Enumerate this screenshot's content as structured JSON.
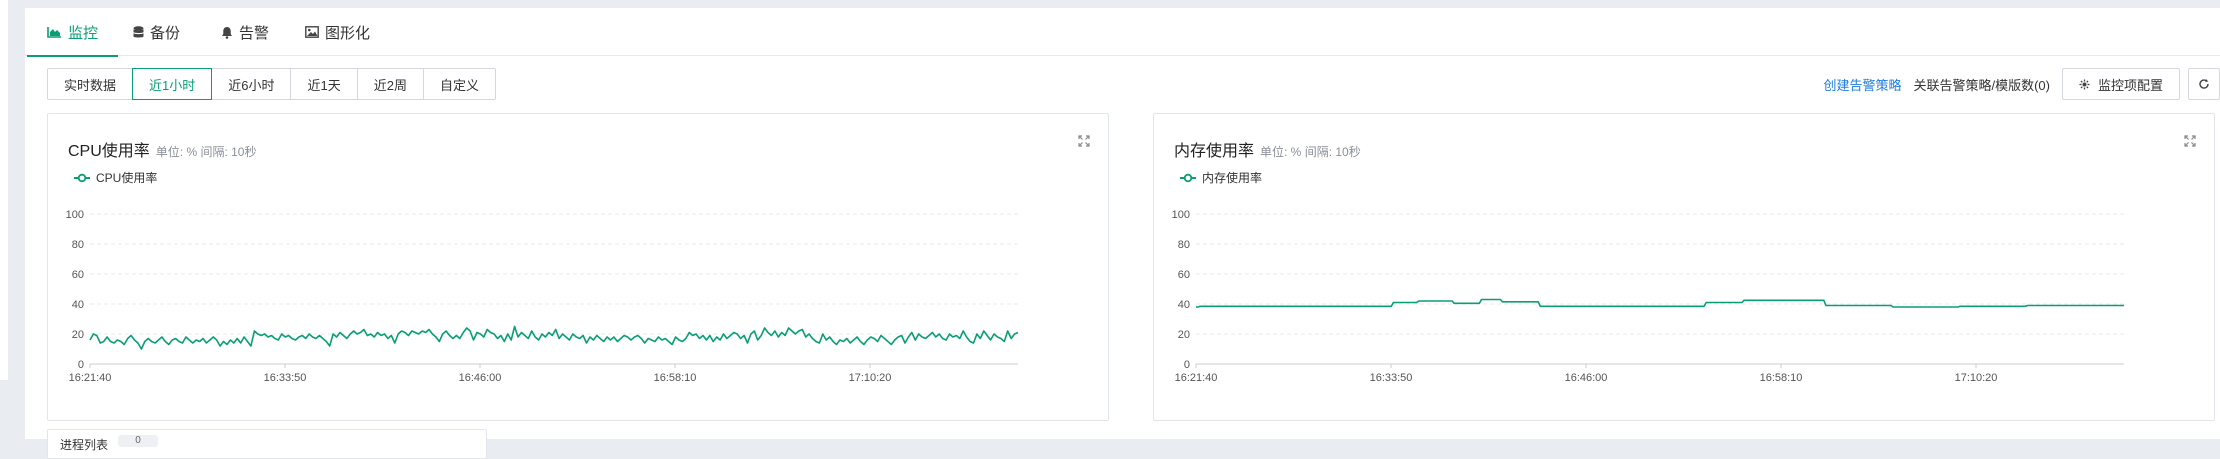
{
  "tabs": [
    {
      "label": "监控",
      "icon": "area-chart-icon",
      "active": true
    },
    {
      "label": "备份",
      "icon": "database-icon",
      "active": false
    },
    {
      "label": "告警",
      "icon": "bell-icon",
      "active": false
    },
    {
      "label": "图形化",
      "icon": "image-icon",
      "active": false
    }
  ],
  "time_ranges": [
    {
      "label": "实时数据",
      "active": false
    },
    {
      "label": "近1小时",
      "active": true
    },
    {
      "label": "近6小时",
      "active": false
    },
    {
      "label": "近1天",
      "active": false
    },
    {
      "label": "近2周",
      "active": false
    },
    {
      "label": "自定义",
      "active": false
    }
  ],
  "actions": {
    "create_alert": "创建告警策略",
    "linked_policies": "关联告警策略/模版数(0)",
    "monitor_config": "监控项配置",
    "refresh_icon": "refresh-icon",
    "config_icon": "settings-icon"
  },
  "colors": {
    "accent": "#0a9d76",
    "link": "#1f7ee0",
    "grid": "#e6e9ee",
    "axis": "#c9ced6"
  },
  "charts": [
    {
      "title": "CPU使用率",
      "subtitle": "单位: % 间隔: 10秒",
      "legend": "CPU使用率"
    },
    {
      "title": "内存使用率",
      "subtitle": "单位: % 间隔: 10秒",
      "legend": "内存使用率"
    }
  ],
  "chart_data": [
    {
      "type": "line",
      "title": "CPU使用率",
      "ylim": [
        0,
        100
      ],
      "yticks": [
        0,
        20,
        40,
        60,
        80,
        100
      ],
      "xticks": [
        "16:21:40",
        "16:33:50",
        "16:46:00",
        "16:58:10",
        "17:10:20"
      ],
      "grid": true,
      "legend_position": "top-left",
      "series": [
        {
          "name": "CPU使用率",
          "color": "#0a9d76",
          "values": [
            16,
            20,
            19,
            14,
            15,
            18,
            15,
            14,
            16,
            15,
            13,
            17,
            19,
            16,
            14,
            10,
            15,
            17,
            15,
            14,
            16,
            18,
            15,
            13,
            16,
            17,
            15,
            14,
            18,
            16,
            14,
            16,
            15,
            17,
            14,
            16,
            18,
            16,
            12,
            15,
            13,
            16,
            14,
            17,
            14,
            18,
            15,
            12,
            22,
            20,
            19,
            20,
            18,
            19,
            17,
            16,
            20,
            18,
            19,
            17,
            16,
            18,
            19,
            17,
            20,
            18,
            17,
            19,
            17,
            15,
            12,
            20,
            18,
            21,
            19,
            17,
            20,
            22,
            20,
            21,
            23,
            19,
            20,
            18,
            21,
            19,
            20,
            17,
            19,
            14,
            20,
            22,
            21,
            19,
            22,
            21,
            20,
            22,
            21,
            23,
            20,
            18,
            15,
            20,
            22,
            19,
            17,
            19,
            17,
            21,
            24,
            22,
            16,
            21,
            20,
            18,
            23,
            21,
            20,
            17,
            19,
            15,
            20,
            16,
            25,
            18,
            21,
            19,
            17,
            22,
            18,
            16,
            20,
            18,
            21,
            19,
            23,
            17,
            20,
            18,
            16,
            20,
            18,
            17,
            19,
            14,
            18,
            16,
            19,
            17,
            15,
            18,
            16,
            18,
            15,
            17,
            19,
            18,
            16,
            18,
            19,
            17,
            14,
            17,
            16,
            15,
            18,
            16,
            17,
            15,
            13,
            18,
            16,
            15,
            17,
            21,
            19,
            20,
            17,
            19,
            16,
            19,
            15,
            18,
            16,
            20,
            17,
            19,
            21,
            20,
            17,
            19,
            14,
            20,
            22,
            16,
            19,
            24,
            21,
            19,
            22,
            18,
            21,
            19,
            24,
            22,
            20,
            22,
            23,
            18,
            20,
            17,
            15,
            14,
            20,
            16,
            18,
            15,
            13,
            16,
            15,
            17,
            14,
            16,
            18,
            15,
            13,
            16,
            18,
            17,
            15,
            19,
            17,
            15,
            13,
            16,
            18,
            19,
            14,
            18,
            21,
            16,
            20,
            18,
            17,
            19,
            21,
            18,
            20,
            17,
            16,
            20,
            18,
            19,
            17,
            22,
            18,
            15,
            14,
            20,
            17,
            22,
            19,
            16,
            20,
            18,
            17,
            15,
            22,
            17,
            20,
            21
          ]
        }
      ]
    },
    {
      "type": "line",
      "title": "内存使用率",
      "ylim": [
        0,
        100
      ],
      "yticks": [
        0,
        20,
        40,
        60,
        80,
        100
      ],
      "xticks": [
        "16:21:40",
        "16:33:50",
        "16:46:00",
        "16:58:10",
        "17:10:20"
      ],
      "grid": true,
      "legend_position": "top-left",
      "series": [
        {
          "name": "内存使用率",
          "color": "#0a9d76",
          "values": [
            38,
            38,
            38.5,
            38.5,
            38.5,
            38.5,
            38.5,
            38.5,
            38.5,
            38.5,
            38.5,
            38.5,
            38.5,
            38.5,
            38.5,
            38.5,
            38.5,
            38.5,
            38.5,
            38.5,
            38.5,
            38.5,
            38.5,
            38.5,
            38.5,
            38.5,
            38.5,
            38.5,
            38.5,
            38.5,
            38.5,
            38.5,
            38.5,
            38.5,
            38.5,
            38.5,
            38.5,
            38.5,
            38.5,
            38.5,
            38.5,
            38.5,
            38.5,
            38.5,
            38.5,
            38.5,
            38.5,
            38.5,
            38.5,
            38.5,
            38.5,
            38.5,
            38.5,
            38.5,
            38.5,
            38.5,
            38.5,
            38.5,
            38.5,
            38.5,
            38.5,
            38.5,
            38.5,
            38.5,
            38.5,
            38.5,
            38.5,
            38.5,
            38.5,
            38.5,
            38.5,
            38.5,
            38.5,
            38.5,
            38.5,
            38.5,
            38.5,
            38.5,
            38.5,
            38.5,
            38.5,
            38.5,
            38.5,
            38.5,
            38.5,
            38.5,
            38.5,
            38.5,
            38.5,
            38.5,
            38.5,
            38.5,
            38.5,
            38.5,
            41,
            41,
            41,
            41,
            41,
            41,
            41,
            41,
            41,
            41,
            41,
            41,
            42,
            42,
            42,
            42,
            42,
            42,
            42,
            42,
            42,
            42,
            42,
            42,
            42,
            42,
            42,
            42,
            42,
            40.5,
            40.5,
            40.5,
            40.5,
            40.5,
            40.5,
            40.5,
            40.5,
            40.5,
            40.5,
            40.5,
            40.5,
            40.5,
            43,
            43,
            43,
            43,
            43,
            43,
            43,
            43,
            43,
            43,
            41.5,
            41.5,
            41.5,
            41.5,
            41.5,
            41.5,
            41.5,
            41.5,
            41.5,
            41.5,
            41.5,
            41.5,
            41.5,
            41.5,
            41.5,
            41.5,
            41.5,
            41.5,
            38.5,
            38.5,
            38.5,
            38.5,
            38.5,
            38.5,
            38.5,
            38.5,
            38.5,
            38.5,
            38.5,
            38.5,
            38.5,
            38.5,
            38.5,
            38.5,
            38.5,
            38.5,
            38.5,
            38.5,
            38.5,
            38.5,
            38.5,
            38.5,
            38.5,
            38.5,
            38.5,
            38.5,
            38.5,
            38.5,
            38.5,
            38.5,
            38.5,
            38.5,
            38.5,
            38.5,
            38.5,
            38.5,
            38.5,
            38.5,
            38.5,
            38.5,
            38.5,
            38.5,
            38.5,
            38.5,
            38.5,
            38.5,
            38.5,
            38.5,
            38.5,
            38.5,
            38.5,
            38.5,
            38.5,
            38.5,
            38.5,
            38.5,
            38.5,
            38.5,
            38.5,
            38.5,
            38.5,
            38.5,
            38.5,
            38.5,
            38.5,
            38.5,
            38.5,
            38.5,
            38.5,
            38.5,
            38.5,
            38.5,
            38.5,
            38.5,
            38.5,
            38.5,
            38.5,
            41,
            41,
            41,
            41,
            41,
            41,
            41,
            41,
            41,
            41,
            41,
            41,
            41,
            41,
            41,
            41,
            41,
            41,
            42.5,
            42.5,
            42.5,
            42.5,
            42.5,
            42.5,
            42.5,
            42.5,
            42.5,
            42.5,
            42.5,
            42.5,
            42.5,
            42.5,
            42.5,
            42.5,
            42.5,
            42.5,
            42.5,
            42.5,
            42.5,
            42.5,
            42.5,
            42.5,
            42.5,
            42.5,
            42.5,
            42.5,
            42.5,
            42.5,
            42.5,
            42.5,
            42.5,
            42.5,
            42.5,
            42.5,
            42.5,
            42.5,
            42.5,
            39,
            39,
            39,
            39,
            39,
            39,
            39,
            39,
            39,
            39,
            39,
            39,
            39,
            39,
            39,
            39,
            39,
            39,
            39,
            39,
            39,
            39,
            39,
            39,
            39,
            39,
            39,
            39,
            39,
            39,
            39,
            39,
            38,
            38,
            38,
            38,
            38,
            38,
            38,
            38,
            38,
            38,
            38,
            38,
            38,
            38,
            38,
            38,
            38,
            38,
            38,
            38,
            38,
            38,
            38,
            38,
            38,
            38,
            38,
            38,
            38,
            38,
            38,
            38,
            38.5,
            38.5,
            38.5,
            38.5,
            38.5,
            38.5,
            38.5,
            38.5,
            38.5,
            38.5,
            38.5,
            38.5,
            38.5,
            38.5,
            38.5,
            38.5,
            38.5,
            38.5,
            38.5,
            38.5,
            38.5,
            38.5,
            38.5,
            38.5,
            38.5,
            38.5,
            38.5,
            38.5,
            38.5,
            38.5,
            38.5,
            38.5,
            39,
            39,
            39,
            39,
            39,
            39,
            39,
            39,
            39,
            39,
            39,
            39,
            39,
            39,
            39,
            39,
            39,
            39,
            39,
            39,
            39,
            39,
            39,
            39,
            39,
            39,
            39,
            39,
            39,
            39,
            39,
            39,
            39,
            39,
            39,
            39,
            39,
            39,
            39,
            39,
            39,
            39,
            39,
            39,
            39,
            39,
            39
          ]
        }
      ]
    }
  ],
  "next_section": {
    "label": "进程列表",
    "badge": "0"
  }
}
